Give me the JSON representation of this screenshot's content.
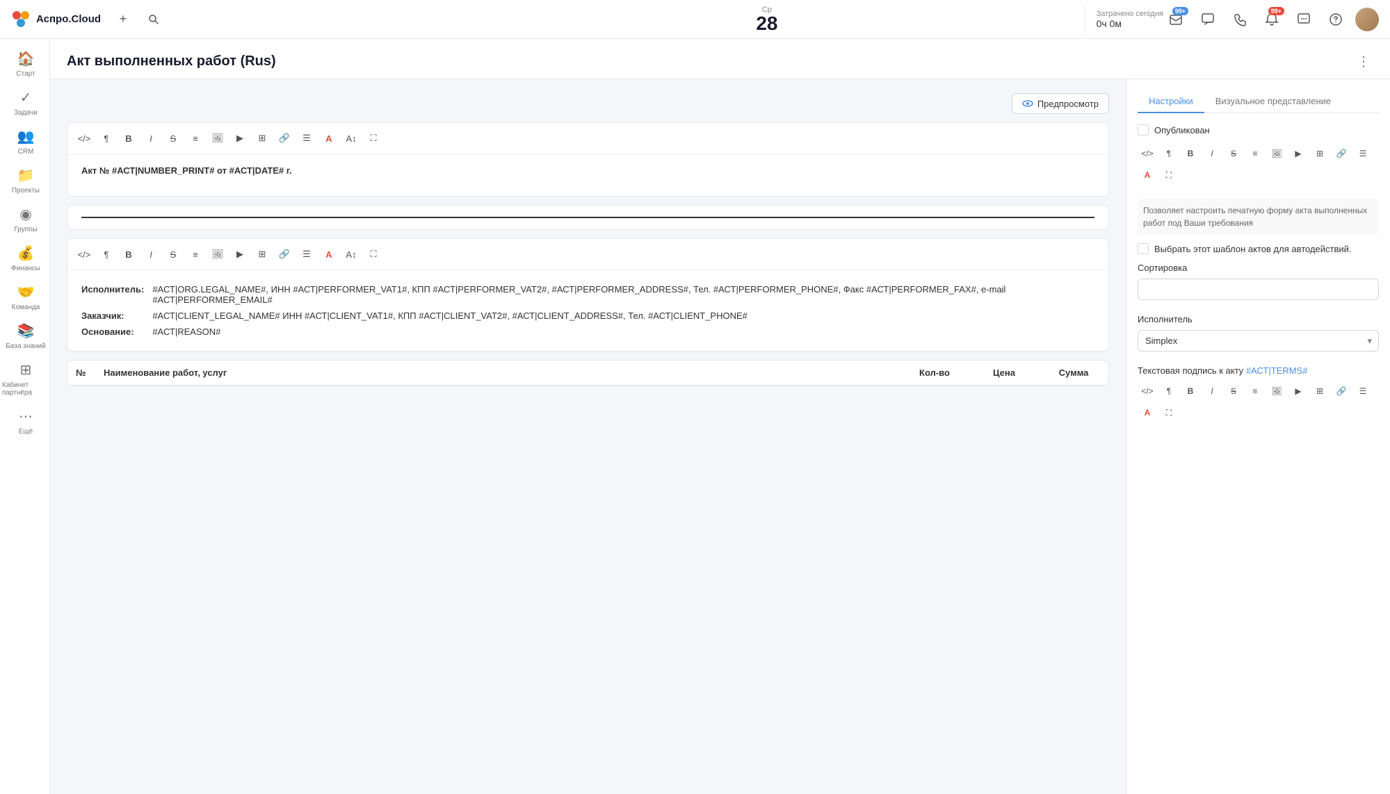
{
  "app": {
    "name": "Аспро.Cloud",
    "logo_text": "Аспро.Cloud"
  },
  "topbar": {
    "add_label": "+",
    "search_label": "🔍",
    "day_of_week": "Ср",
    "date_number": "28",
    "spent_label": "Затрачено сегодня",
    "spent_value": "0ч 0м",
    "badge1_count": "99+",
    "badge2_count": "99+",
    "three_dots_label": "⋮"
  },
  "sidebar": {
    "items": [
      {
        "label": "Старт",
        "icon": "🏠"
      },
      {
        "label": "Задачи",
        "icon": "✓"
      },
      {
        "label": "CRM",
        "icon": "👥"
      },
      {
        "label": "Проекты",
        "icon": "📁"
      },
      {
        "label": "Группы",
        "icon": "◉"
      },
      {
        "label": "Финансы",
        "icon": "💰"
      },
      {
        "label": "Команда",
        "icon": "🤝"
      },
      {
        "label": "База знаний",
        "icon": "📚"
      },
      {
        "label": "Кабинет партнёра",
        "icon": "⊞"
      },
      {
        "label": "Ещё",
        "icon": "⋯"
      }
    ]
  },
  "page": {
    "title": "Акт выполненных работ (Rus)",
    "preview_btn": "Предпросмотр"
  },
  "editor": {
    "block1_text": "Акт № #АСТ|NUMBER_PRINT# от #АСТ|DATE# г.",
    "info_rows": [
      {
        "label": "Исполнитель:",
        "value": "#АСТ|ORG.LEGAL_NAME#, ИНН #АСТ|PERFORMER_VAT1#, КПП #АСТ|PERFORMER_VAT2#, #АСТ|PERFORMER_ADDRESS#, Тел. #АСТ|PERFORMER_PHONE#, Факс #АСТ|PERFORMER_FAX#, e-mail #АСТ|PERFORMER_EMAIL#"
      },
      {
        "label": "Заказчик:",
        "value": "#АСТ|CLIENT_LEGAL_NAME# ИНН #АСТ|CLIENT_VAT1#, КПП #АСТ|CLIENT_VAT2#, #АСТ|CLIENT_ADDRESS#, Тел. #АСТ|CLIENT_PHONE#"
      },
      {
        "label": "Основание:",
        "value": "#АСТ|REASON#"
      }
    ],
    "table_headers": [
      "№",
      "Наименование работ, услуг",
      "Кол-во",
      "Цена",
      "Сумма"
    ]
  },
  "right_panel": {
    "tab_settings": "Настройки",
    "tab_visual": "Визуальное представление",
    "published_label": "Опубликован",
    "auto_action_label": "Выбрать этот шаблон актов для автодействий.",
    "sort_label": "Сортировка",
    "performer_label": "Исполнитель",
    "performer_value": "Simplex",
    "text_sign_label": "Текстовая подпись к акту",
    "text_sign_hint": "#АСТ|TERMS#",
    "description": "Позволяет настроить печатную форму акта выполненных работ под Ваши требования"
  }
}
